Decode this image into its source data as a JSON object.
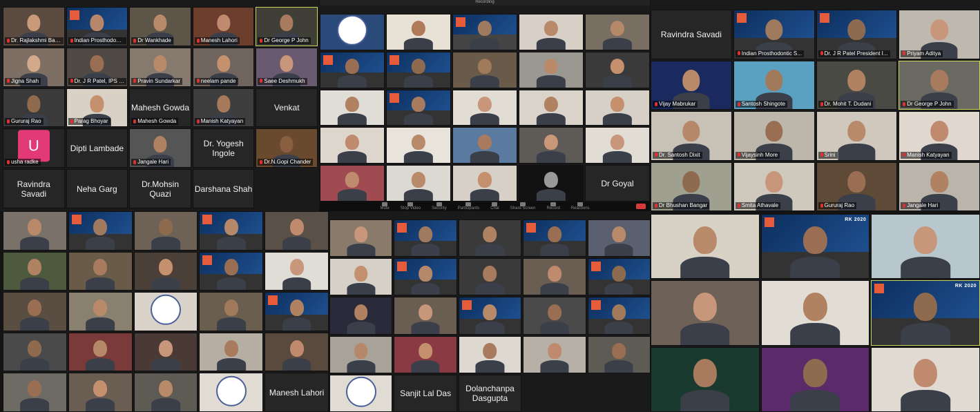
{
  "panels": [
    {
      "id": "p1",
      "tiles": [
        {
          "name": "Dr. Rajlakshmi Banerjee",
          "skin": "#c99a7a",
          "bg": "#5a4a40"
        },
        {
          "name": "Indian Prosthodontic S...",
          "slide": true,
          "skin": "#b8866a",
          "bg": "#333"
        },
        {
          "name": "Dr Wankhade",
          "skin": "#b88a6a",
          "bg": "#5c5548"
        },
        {
          "name": "Manesh Lahori",
          "skin": "#c08a6e",
          "bg": "#6b3e2e"
        },
        {
          "name": "Dr George P John",
          "skin": "#a87a5e",
          "bg": "#3f3f38",
          "active": true
        },
        {
          "name": "Jigna Shah",
          "skin": "#d3a98c",
          "bg": "#7d6f63"
        },
        {
          "name": "Dr. J R Patel, IPS Presid...",
          "skin": "#9a6e52",
          "bg": "#4f4a45"
        },
        {
          "name": "Pravin Sundarkar",
          "skin": "#b98a6a",
          "bg": "#867a6e"
        },
        {
          "name": "neelam pande",
          "skin": "#c5906e",
          "bg": "#70655e"
        },
        {
          "name": "Saee Deshmukh",
          "skin": "#c8967a",
          "bg": "#6a5a70"
        },
        {
          "name": "Gururaj Rao",
          "skin": "#8e6a4e",
          "bg": "#3a3a3a"
        },
        {
          "name": "Parag Bhoyar",
          "skin": "#c5906e",
          "bg": "#d9d1c6"
        },
        {
          "name": "Mahesh Gowda",
          "label": "Mahesh Gowda",
          "blank": true
        },
        {
          "name": "Manish Katyayan",
          "skin": "#a67a5a",
          "bg": "#3e3e3e"
        },
        {
          "name": "",
          "label": "Venkat",
          "blank": true
        },
        {
          "name": "usha radke",
          "avatar": "U",
          "blank": true
        },
        {
          "name": "",
          "label": "Dipti Lambade",
          "blank": true
        },
        {
          "name": "Jangale Hari",
          "skin": "#b08262",
          "bg": "#555"
        },
        {
          "name": "",
          "label": "Dr. Yogesh Ingole",
          "blank": true
        },
        {
          "name": "Dr.N.Gopi Chander",
          "skin": "#8a5e40",
          "bg": "#6a4a2e"
        },
        {
          "name": "",
          "label": "Ravindra Savadi",
          "blank": true
        },
        {
          "name": "",
          "label": "Neha Garg",
          "blank": true
        },
        {
          "name": "",
          "label": "Dr.Mohsin Quazi",
          "blank": true
        },
        {
          "name": "",
          "label": "Darshana Shah",
          "blank": true
        }
      ]
    },
    {
      "id": "p2",
      "meeting_title": "Recording",
      "toolbar": [
        "Mute",
        "Stop Video",
        "Security",
        "Participants",
        "Chat",
        "Share Screen",
        "Record",
        "Reactions"
      ],
      "tiles": [
        {
          "name": "",
          "emblem": true,
          "bg": "#2a4a7a"
        },
        {
          "name": "",
          "skin": "#b07a5a",
          "bg": "#e8e2d6"
        },
        {
          "name": "",
          "slide": true,
          "skin": "#a07a5e",
          "bg": "#444"
        },
        {
          "name": "",
          "skin": "#b88a6a",
          "bg": "#d8d0c6"
        },
        {
          "name": "",
          "skin": "#b48868",
          "bg": "#786e62"
        },
        {
          "name": "",
          "slide": true,
          "skin": "#9a6e52",
          "bg": "#333"
        },
        {
          "name": "",
          "slide": true,
          "skin": "#8e6a4e",
          "bg": "#333"
        },
        {
          "name": "",
          "skin": "#a07a5a",
          "bg": "#6a5a4a"
        },
        {
          "name": "",
          "skin": "#b88a6a",
          "bg": "#9a9890"
        },
        {
          "name": "",
          "skin": "#c5906e",
          "bg": "#3a3a3a"
        },
        {
          "name": "",
          "skin": "#b08262",
          "bg": "#e0dcd6"
        },
        {
          "name": "",
          "slide": true,
          "skin": "#a87a5e",
          "bg": "#333"
        },
        {
          "name": "",
          "skin": "#c8967a",
          "bg": "#e2ddd4"
        },
        {
          "name": "",
          "skin": "#b08262",
          "bg": "#d9d3ca"
        },
        {
          "name": "",
          "skin": "#c5906e",
          "bg": "#d6d0c6"
        },
        {
          "name": "",
          "skin": "#c08a6e",
          "bg": "#ddd6cc"
        },
        {
          "name": "",
          "skin": "#b88a6a",
          "bg": "#e8e4dc"
        },
        {
          "name": "",
          "skin": "#a87a5e",
          "bg": "#5a7aa0"
        },
        {
          "name": "",
          "skin": "#c89878",
          "bg": "#5e5a56"
        },
        {
          "name": "",
          "skin": "#c8967a",
          "bg": "#e2ddd4"
        },
        {
          "name": "",
          "skin": "#c08a6e",
          "bg": "#a04a52"
        },
        {
          "name": "",
          "skin": "#b88a6a",
          "bg": "#dcd8d2"
        },
        {
          "name": "",
          "skin": "#c5906e",
          "bg": "#d6d0c6"
        },
        {
          "name": "",
          "skin": "#999",
          "bg": "#111"
        },
        {
          "name": "",
          "label": "Dr Goyal",
          "blank": true
        }
      ]
    },
    {
      "id": "p3",
      "tiles": [
        {
          "name": "",
          "label": "Ravindra Savadi",
          "blank": true
        },
        {
          "name": "Indian Prosthodontic S...",
          "slide": true,
          "skin": "#a07a5e",
          "bg": "#333"
        },
        {
          "name": "Dr. J R Patel President I...",
          "slide": true,
          "skin": "#8e6a4e",
          "bg": "#333"
        },
        {
          "name": "Priyam Aditya",
          "skin": "#c8967a",
          "bg": "#bfb8ae"
        },
        {
          "name": "Vijay Mabrukar",
          "skin": "#b88a6a",
          "bg": "#1a2a5e"
        },
        {
          "name": "Santosh Shingote",
          "skin": "#a07a5a",
          "bg": "#5aa0c0"
        },
        {
          "name": "Dr. Mohit T. Dudani",
          "skin": "#b08262",
          "bg": "#4a4a44"
        },
        {
          "name": "Dr George P John",
          "skin": "#a87a5e",
          "bg": "#6a6a62",
          "active": true
        },
        {
          "name": "Dr. Santosh Dixit",
          "skin": "#b48868",
          "bg": "#c8c2b6"
        },
        {
          "name": "Vijaysinh More",
          "skin": "#9a6e52",
          "bg": "#bdb6aa"
        },
        {
          "name": "Srini",
          "skin": "#b88a6a",
          "bg": "#d0c8bc"
        },
        {
          "name": "Manish Katyayan",
          "skin": "#c08a6e",
          "bg": "#e0d8ce"
        },
        {
          "name": "Dr Bhushan Bangar",
          "skin": "#8e6a4e",
          "bg": "#a0a090"
        },
        {
          "name": "Smita Athavale",
          "skin": "#c8967a",
          "bg": "#cfc8bd"
        },
        {
          "name": "Gururaj Rao",
          "skin": "#9a6e52",
          "bg": "#5e4a36"
        },
        {
          "name": "Jangale Hari",
          "skin": "#b08262",
          "bg": "#bab4aa"
        }
      ]
    },
    {
      "id": "p4",
      "tiles": [
        {
          "name": "",
          "skin": "#b88a6a",
          "bg": "#7a7268"
        },
        {
          "name": "",
          "slide": true,
          "skin": "#a07a5e",
          "bg": "#333"
        },
        {
          "name": "",
          "skin": "#8e6a4e",
          "bg": "#6e6256"
        },
        {
          "name": "",
          "slide": true,
          "skin": "#b48868",
          "bg": "#333"
        },
        {
          "name": "",
          "skin": "#c08a6e",
          "bg": "#5a5048"
        },
        {
          "name": "",
          "skin": "#b08262",
          "bg": "#4e5a3e"
        },
        {
          "name": "",
          "skin": "#a87a5e",
          "bg": "#6a5a48"
        },
        {
          "name": "",
          "skin": "#c5906e",
          "bg": "#4a4038"
        },
        {
          "name": "",
          "slide": true,
          "skin": "#9a6e52",
          "bg": "#333"
        },
        {
          "name": "",
          "skin": "#c8967a",
          "bg": "#e0dcd6"
        },
        {
          "name": "",
          "skin": "#9a6e52",
          "bg": "#5a4e42"
        },
        {
          "name": "",
          "skin": "#b88a6a",
          "bg": "#8a8070"
        },
        {
          "name": "",
          "emblem": true,
          "bg": "#d8d2c8"
        },
        {
          "name": "",
          "skin": "#a07a5a",
          "bg": "#6a5e4e"
        },
        {
          "name": "",
          "slide": true,
          "skin": "#b08262",
          "bg": "#333"
        },
        {
          "name": "",
          "skin": "#8e6a4e",
          "bg": "#4a4a4a"
        },
        {
          "name": "",
          "skin": "#b48868",
          "bg": "#7a3a3a"
        },
        {
          "name": "",
          "skin": "#c8967a",
          "bg": "#4a3a36"
        },
        {
          "name": "",
          "skin": "#a87a5e",
          "bg": "#b6aea2"
        },
        {
          "name": "",
          "skin": "#c08a6e",
          "bg": "#5a4a3e"
        },
        {
          "name": "",
          "skin": "#9a6e52",
          "bg": "#6e6a64"
        },
        {
          "name": "",
          "skin": "#c5906e",
          "bg": "#6a5e52"
        },
        {
          "name": "",
          "skin": "#b88a6a",
          "bg": "#5e5a54"
        },
        {
          "name": "",
          "emblem": true,
          "bg": "#e0dcd4"
        },
        {
          "name": "",
          "label": "Manesh Lahori",
          "blank": true
        }
      ]
    },
    {
      "id": "p5",
      "tiles": [
        {
          "name": "",
          "skin": "#c8967a",
          "bg": "#8a7a6a"
        },
        {
          "name": "",
          "slide": true,
          "skin": "#a07a5e",
          "bg": "#333"
        },
        {
          "name": "",
          "skin": "#b08262",
          "bg": "#3a3a3a"
        },
        {
          "name": "",
          "slide": true,
          "skin": "#9a6e52",
          "bg": "#333"
        },
        {
          "name": "",
          "skin": "#b88a6a",
          "bg": "#5a6070"
        },
        {
          "name": "",
          "skin": "#c5906e",
          "bg": "#d6d0c6"
        },
        {
          "name": "",
          "slide": true,
          "skin": "#b48868",
          "bg": "#333"
        },
        {
          "name": "",
          "skin": "#a87a5e",
          "bg": "#3a3a3a"
        },
        {
          "name": "",
          "skin": "#c08a6e",
          "bg": "#6a5e52"
        },
        {
          "name": "",
          "slide": true,
          "skin": "#8e6a4e",
          "bg": "#333"
        },
        {
          "name": "",
          "skin": "#b08262",
          "bg": "#2a2a3a"
        },
        {
          "name": "",
          "skin": "#c8967a",
          "bg": "#6a5e52"
        },
        {
          "name": "",
          "slide": true,
          "skin": "#b88a6a",
          "bg": "#333"
        },
        {
          "name": "",
          "skin": "#9a6e52",
          "bg": "#4a4a4a"
        },
        {
          "name": "",
          "slide": true,
          "skin": "#a07a5a",
          "bg": "#333"
        },
        {
          "name": "",
          "skin": "#b48868",
          "bg": "#a8a298"
        },
        {
          "name": "",
          "skin": "#c5906e",
          "bg": "#8a3a42"
        },
        {
          "name": "",
          "skin": "#a87a5e",
          "bg": "#ddd8d0"
        },
        {
          "name": "",
          "skin": "#c08a6e",
          "bg": "#b6b0a6"
        },
        {
          "name": "",
          "skin": "#9a6e52",
          "bg": "#5e5a54"
        },
        {
          "name": "",
          "emblem": true,
          "bg": "#e0dcd4"
        },
        {
          "name": "",
          "label": "Sanjit Lal Das",
          "blank": true
        },
        {
          "name": "",
          "label": "Dolanchanpa Dasgupta",
          "blank": true
        }
      ]
    },
    {
      "id": "p6",
      "tiles": [
        {
          "name": "",
          "skin": "#b88a6a",
          "bg": "#d8d2c6"
        },
        {
          "name": "",
          "slide": true,
          "slide_text": "RK 2020",
          "skin": "#9a6e52",
          "bg": "#333"
        },
        {
          "name": "",
          "skin": "#c8967a",
          "bg": "#b8c6ce"
        },
        {
          "name": "",
          "skin": "#c8967a",
          "bg": "#6e6258"
        },
        {
          "name": "",
          "skin": "#b08262",
          "bg": "#e2ddd4"
        },
        {
          "name": "",
          "slide": true,
          "slide_text": "RK 2020",
          "skin": "#8e6a4e",
          "bg": "#333",
          "active": true
        },
        {
          "name": "",
          "skin": "#a87a5e",
          "bg": "#1a3a30"
        },
        {
          "name": "",
          "skin": "#8e6a4e",
          "bg": "#5a2a6a"
        },
        {
          "name": "",
          "skin": "#c08a6e",
          "bg": "#e0dad2"
        }
      ]
    }
  ],
  "colors": {
    "active_speaker": "#c8d65a",
    "muted_mic": "#e03030",
    "avatar_bg": "#e23a76"
  }
}
